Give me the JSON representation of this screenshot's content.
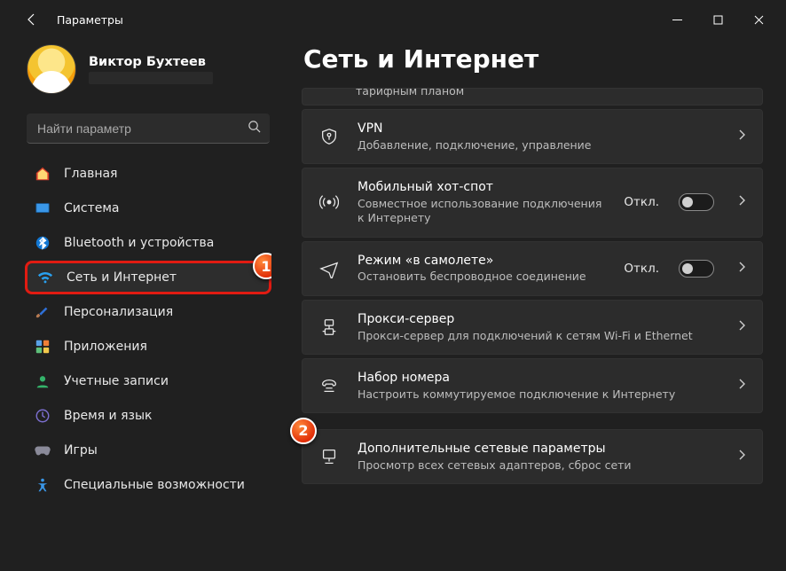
{
  "window": {
    "title": "Параметры"
  },
  "profile": {
    "name": "Виктор Бухтеев"
  },
  "search": {
    "placeholder": "Найти параметр"
  },
  "sidebar": {
    "items": [
      {
        "label": "Главная"
      },
      {
        "label": "Система"
      },
      {
        "label": "Bluetooth и устройства"
      },
      {
        "label": "Сеть и Интернет"
      },
      {
        "label": "Персонализация"
      },
      {
        "label": "Приложения"
      },
      {
        "label": "Учетные записи"
      },
      {
        "label": "Время и язык"
      },
      {
        "label": "Игры"
      },
      {
        "label": "Специальные возможности"
      }
    ]
  },
  "callouts": {
    "one": "1",
    "two": "2"
  },
  "page": {
    "title": "Сеть и Интернет",
    "toggleOff": "Откл.",
    "partial": "тарифным планом",
    "cards": [
      {
        "title": "VPN",
        "sub": "Добавление, подключение, управление"
      },
      {
        "title": "Мобильный хот-спот",
        "sub": "Совместное использование подключения к Интернету"
      },
      {
        "title": "Режим «в самолете»",
        "sub": "Остановить беспроводное соединение"
      },
      {
        "title": "Прокси-сервер",
        "sub": "Прокси-сервер для подключений к сетям Wi-Fi и Ethernet"
      },
      {
        "title": "Набор номера",
        "sub": "Настроить коммутируемое подключение к Интернету"
      },
      {
        "title": "Дополнительные сетевые параметры",
        "sub": "Просмотр всех сетевых адаптеров, сброс сети"
      }
    ]
  }
}
